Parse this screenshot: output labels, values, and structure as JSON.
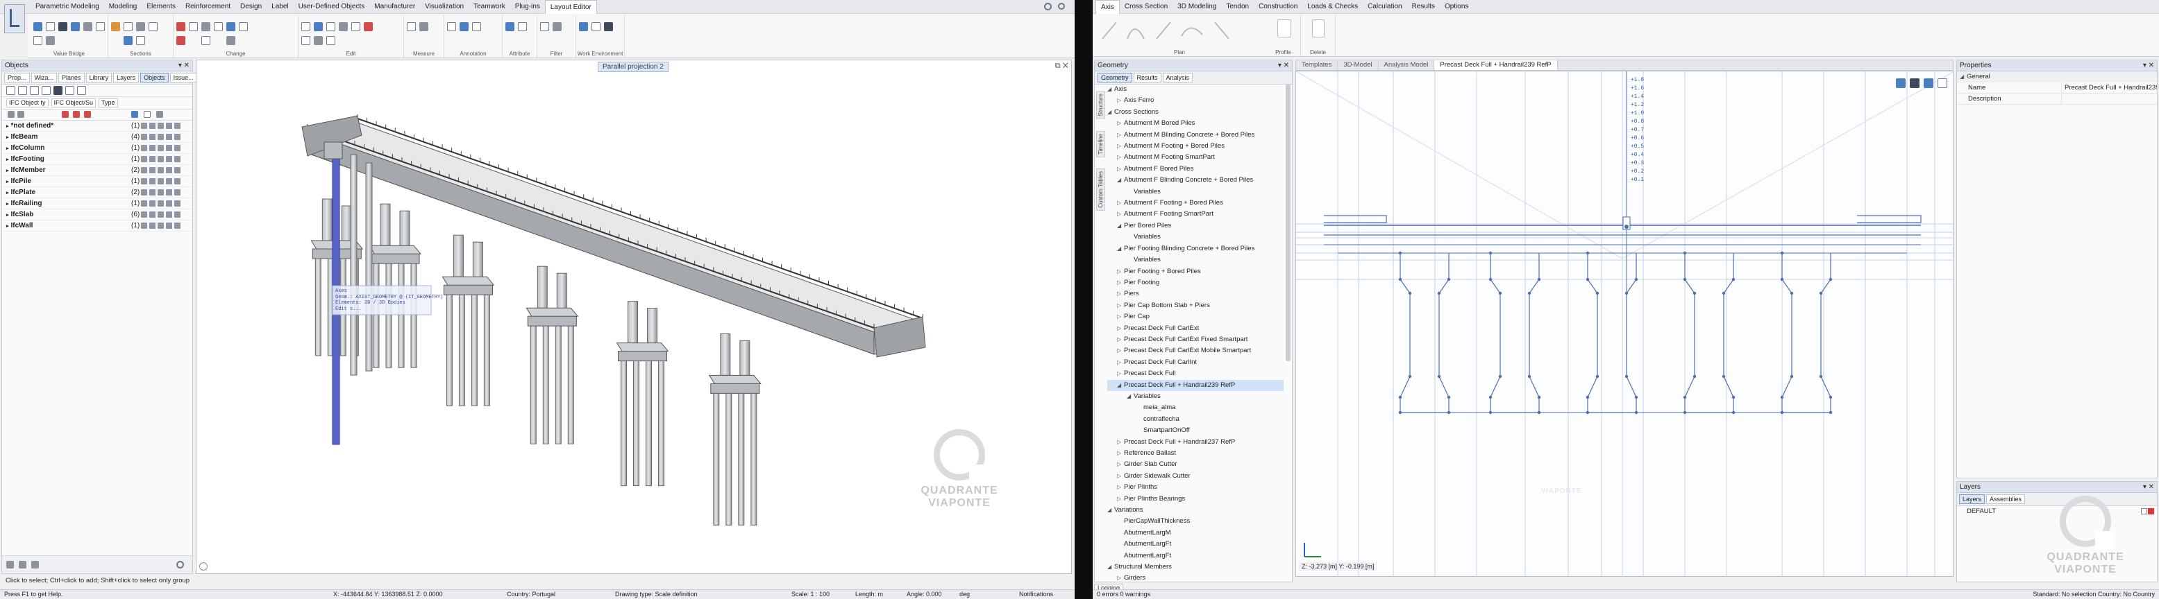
{
  "left_app": {
    "menu": [
      "Parametric Modeling",
      "Modeling",
      "Elements",
      "Reinforcement",
      "Design",
      "Label",
      "User-Defined Objects",
      "Manufacturer",
      "Visualization",
      "Teamwork",
      "Plug-ins",
      "Layout Editor"
    ],
    "active_menu": "Layout Editor",
    "ribbon_groups": [
      "Value Bridge",
      "Sections",
      "Change",
      "Edit",
      "Measure",
      "Annotation",
      "Attribute",
      "Filter",
      "Work Environment"
    ],
    "objects_panel": {
      "title": "Objects",
      "tabs": [
        "Prop...",
        "Wiza...",
        "Planes",
        "Library",
        "Layers",
        "Objects",
        "Issue..."
      ],
      "active_tab": "Objects",
      "filter_buttons": [
        "IFC Object ty",
        "IFC Object/Su",
        "Type"
      ],
      "rows": [
        {
          "name": "*not defined*",
          "count": "(1)"
        },
        {
          "name": "IfcBeam",
          "count": "(4)"
        },
        {
          "name": "IfcColumn",
          "count": "(1)"
        },
        {
          "name": "IfcFooting",
          "count": "(1)"
        },
        {
          "name": "IfcMember",
          "count": "(2)"
        },
        {
          "name": "IfcPile",
          "count": "(1)"
        },
        {
          "name": "IfcPlate",
          "count": "(2)"
        },
        {
          "name": "IfcRailing",
          "count": "(1)"
        },
        {
          "name": "IfcSlab",
          "count": "(6)"
        },
        {
          "name": "IfcWall",
          "count": "(1)"
        }
      ]
    },
    "view_tooltip": "Parallel projection 2",
    "tooltip_box": [
      "Axes",
      "Geom.: AXIST_GEOMETRY @ (IT_GEOMETRY)",
      "Elements: 2D / 3D Bodies",
      "Edit s..."
    ],
    "hint": "Click to select; Ctrl+click to add; Shift+click to select only group",
    "status": {
      "f1": "Press F1 to get Help.",
      "coords": "X: -443644.84  Y: 1363988.51  Z: 0.0000",
      "country": "Country:  Portugal",
      "drawing_type": "Drawing type:  Scale definition",
      "scale": "Scale:  1 : 100",
      "length": "Length:  m",
      "angle": "Angle:  0.000",
      "deg": "deg",
      "notifications": "Notifications"
    }
  },
  "right_app": {
    "menu": [
      "Axis",
      "Cross Section",
      "3D Modeling",
      "Tendon",
      "Construction",
      "Loads & Checks",
      "Calculation",
      "Results",
      "Options"
    ],
    "active_menu": "Axis",
    "ribbon_groups": [
      "Plan",
      "Profile",
      "Delete"
    ],
    "geometry_panel": {
      "title": "Geometry",
      "tabs": [
        "Geometry",
        "Results",
        "Analysis"
      ],
      "vertical_tabs": [
        "Structure",
        "Timeline",
        "Custom Tables"
      ],
      "tree": [
        {
          "level": 0,
          "icon": "down",
          "text": "Axis"
        },
        {
          "level": 1,
          "icon": "right",
          "text": "Axis Ferro"
        },
        {
          "level": 0,
          "icon": "down",
          "text": "Cross Sections"
        },
        {
          "level": 1,
          "icon": "right",
          "text": "Abutment M Bored Piles"
        },
        {
          "level": 1,
          "icon": "right",
          "text": "Abutment M Blinding Concrete + Bored Piles"
        },
        {
          "level": 1,
          "icon": "right",
          "text": "Abutment M Footing + Bored Piles"
        },
        {
          "level": 1,
          "icon": "right",
          "text": "Abutment M Footing SmartPart"
        },
        {
          "level": 1,
          "icon": "right",
          "text": "Abutment F Bored Piles"
        },
        {
          "level": 1,
          "icon": "down",
          "text": "Abutment F Blinding Concrete + Bored Piles"
        },
        {
          "level": 2,
          "icon": "none",
          "text": "Variables"
        },
        {
          "level": 1,
          "icon": "right",
          "text": "Abutment F Footing + Bored Piles"
        },
        {
          "level": 1,
          "icon": "right",
          "text": "Abutment F Footing SmartPart"
        },
        {
          "level": 1,
          "icon": "down",
          "text": "Pier Bored Piles"
        },
        {
          "level": 2,
          "icon": "none",
          "text": "Variables"
        },
        {
          "level": 1,
          "icon": "down",
          "text": "Pier Footing Blinding Concrete + Bored Piles"
        },
        {
          "level": 2,
          "icon": "none",
          "text": "Variables"
        },
        {
          "level": 1,
          "icon": "right",
          "text": "Pier Footing + Bored Piles"
        },
        {
          "level": 1,
          "icon": "right",
          "text": "Pier Footing"
        },
        {
          "level": 1,
          "icon": "right",
          "text": "Piers"
        },
        {
          "level": 1,
          "icon": "right",
          "text": "Pier Cap Bottom Slab + Piers"
        },
        {
          "level": 1,
          "icon": "right",
          "text": "Pier Cap"
        },
        {
          "level": 1,
          "icon": "right",
          "text": "Precast Deck Full CarlExt"
        },
        {
          "level": 1,
          "icon": "right",
          "text": "Precast Deck Full CarlExt Fixed Smartpart"
        },
        {
          "level": 1,
          "icon": "right",
          "text": "Precast Deck Full CarlExt Mobile Smartpart"
        },
        {
          "level": 1,
          "icon": "right",
          "text": "Precast Deck Full CarlInt"
        },
        {
          "level": 1,
          "icon": "right",
          "text": "Precast Deck Full"
        },
        {
          "level": 1,
          "icon": "down",
          "text": "Precast Deck Full + Handrail239 RefP",
          "selected": true
        },
        {
          "level": 2,
          "icon": "down",
          "text": "Variables"
        },
        {
          "level": 3,
          "icon": "none",
          "text": "meia_alma"
        },
        {
          "level": 3,
          "icon": "none",
          "text": "contraflecha"
        },
        {
          "level": 3,
          "icon": "none",
          "text": "SmartpartOnOff"
        },
        {
          "level": 1,
          "icon": "right",
          "text": "Precast Deck Full + Handrail237 RefP"
        },
        {
          "level": 1,
          "icon": "right",
          "text": "Reference Ballast"
        },
        {
          "level": 1,
          "icon": "right",
          "text": "Girder Slab Cutter"
        },
        {
          "level": 1,
          "icon": "right",
          "text": "Girder Sidewalk Cutter"
        },
        {
          "level": 1,
          "icon": "right",
          "text": "Pier Plinths"
        },
        {
          "level": 1,
          "icon": "right",
          "text": "Pier Plinths Bearings"
        },
        {
          "level": 0,
          "icon": "down",
          "text": "Variations"
        },
        {
          "level": 1,
          "icon": "none",
          "text": "PierCapWallThickness"
        },
        {
          "level": 1,
          "icon": "none",
          "text": "AbutmentLargM"
        },
        {
          "level": 1,
          "icon": "none",
          "text": "AbutmentLargFt"
        },
        {
          "level": 1,
          "icon": "none",
          "text": "AbutmentLargFt"
        },
        {
          "level": 0,
          "icon": "down",
          "text": "Structural Members"
        },
        {
          "level": 1,
          "icon": "right",
          "text": "Girders"
        }
      ]
    },
    "doc_tabs": [
      "Templates",
      "3D-Model",
      "Analysis Model",
      "Precast Deck Full + Handrail239 RefP"
    ],
    "active_doc_tab": "Precast Deck Full + Handrail239 RefP",
    "cross_section_readout": "Z: -3.273 [m]  Y: -0.199 [m]",
    "dim_labels": [
      "+1.8",
      "+1.6",
      "+1.4",
      "+1.2",
      "+1.0",
      "+0.8",
      "+0.7",
      "+0.6",
      "+0.5",
      "+0.4",
      "+0.3",
      "+0.2",
      "+0.1"
    ],
    "properties": {
      "title": "Properties",
      "section": "General",
      "rows": [
        {
          "key": "Name",
          "value": "Precast Deck Full + Handrail239 RefP"
        },
        {
          "key": "Description",
          "value": ""
        }
      ]
    },
    "layers": {
      "title": "Layers",
      "tabs": [
        "Layers",
        "Assemblies"
      ],
      "items": [
        "DEFAULT"
      ]
    },
    "logging_tab": "Logging",
    "status_left": "0 errors 0 warnings",
    "status_right": "Standard: No selection  Country: No Country"
  },
  "watermark": [
    "QUADRANTE",
    "VIAPONTE"
  ]
}
